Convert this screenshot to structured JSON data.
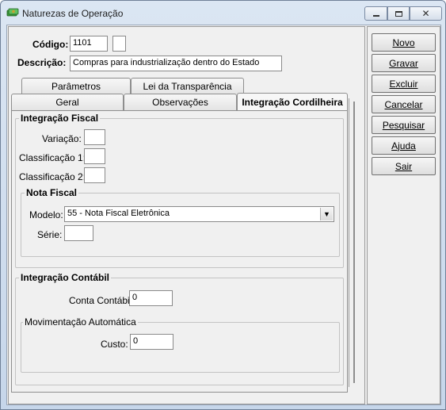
{
  "window": {
    "title": "Naturezas de Operação"
  },
  "header": {
    "codigo_label": "Código:",
    "codigo_value": "1101",
    "codigo_extra_value": "",
    "descricao_label": "Descrição:",
    "descricao_value": "Compras para industrialização dentro do Estado"
  },
  "tabs": {
    "row1": [
      "Parâmetros",
      "Lei da Transparência"
    ],
    "row2": [
      "Geral",
      "Observações",
      "Integração Cordilheira"
    ],
    "active": "Integração Cordilheira"
  },
  "integracao_fiscal": {
    "title": "Integração Fiscal",
    "variacao_label": "Variação:",
    "variacao_value": "",
    "classificacao1_label": "Classificação 1:",
    "classificacao1_value": "",
    "classificacao2_label": "Classificação 2:",
    "classificacao2_value": ""
  },
  "nota_fiscal": {
    "title": "Nota Fiscal",
    "modelo_label": "Modelo:",
    "modelo_value": "55 - Nota Fiscal Eletrônica",
    "serie_label": "Série:",
    "serie_value": ""
  },
  "integracao_contabil": {
    "title": "Integração Contábil",
    "conta_label": "Conta Contábil:",
    "conta_value": "0"
  },
  "movimentacao": {
    "title": "Movimentação Automática",
    "custo_label": "Custo:",
    "custo_value": "0"
  },
  "buttons": {
    "novo": "Novo",
    "gravar": "Gravar",
    "excluir": "Excluir",
    "cancelar": "Cancelar",
    "pesquisar": "Pesquisar",
    "ajuda": "Ajuda",
    "sair": "Sair"
  },
  "icons": {
    "app": "green-money-icon",
    "minimize": "minimize-icon",
    "maximize": "maximize-icon",
    "close": "close-icon",
    "dropdown": "chevron-down-icon"
  }
}
